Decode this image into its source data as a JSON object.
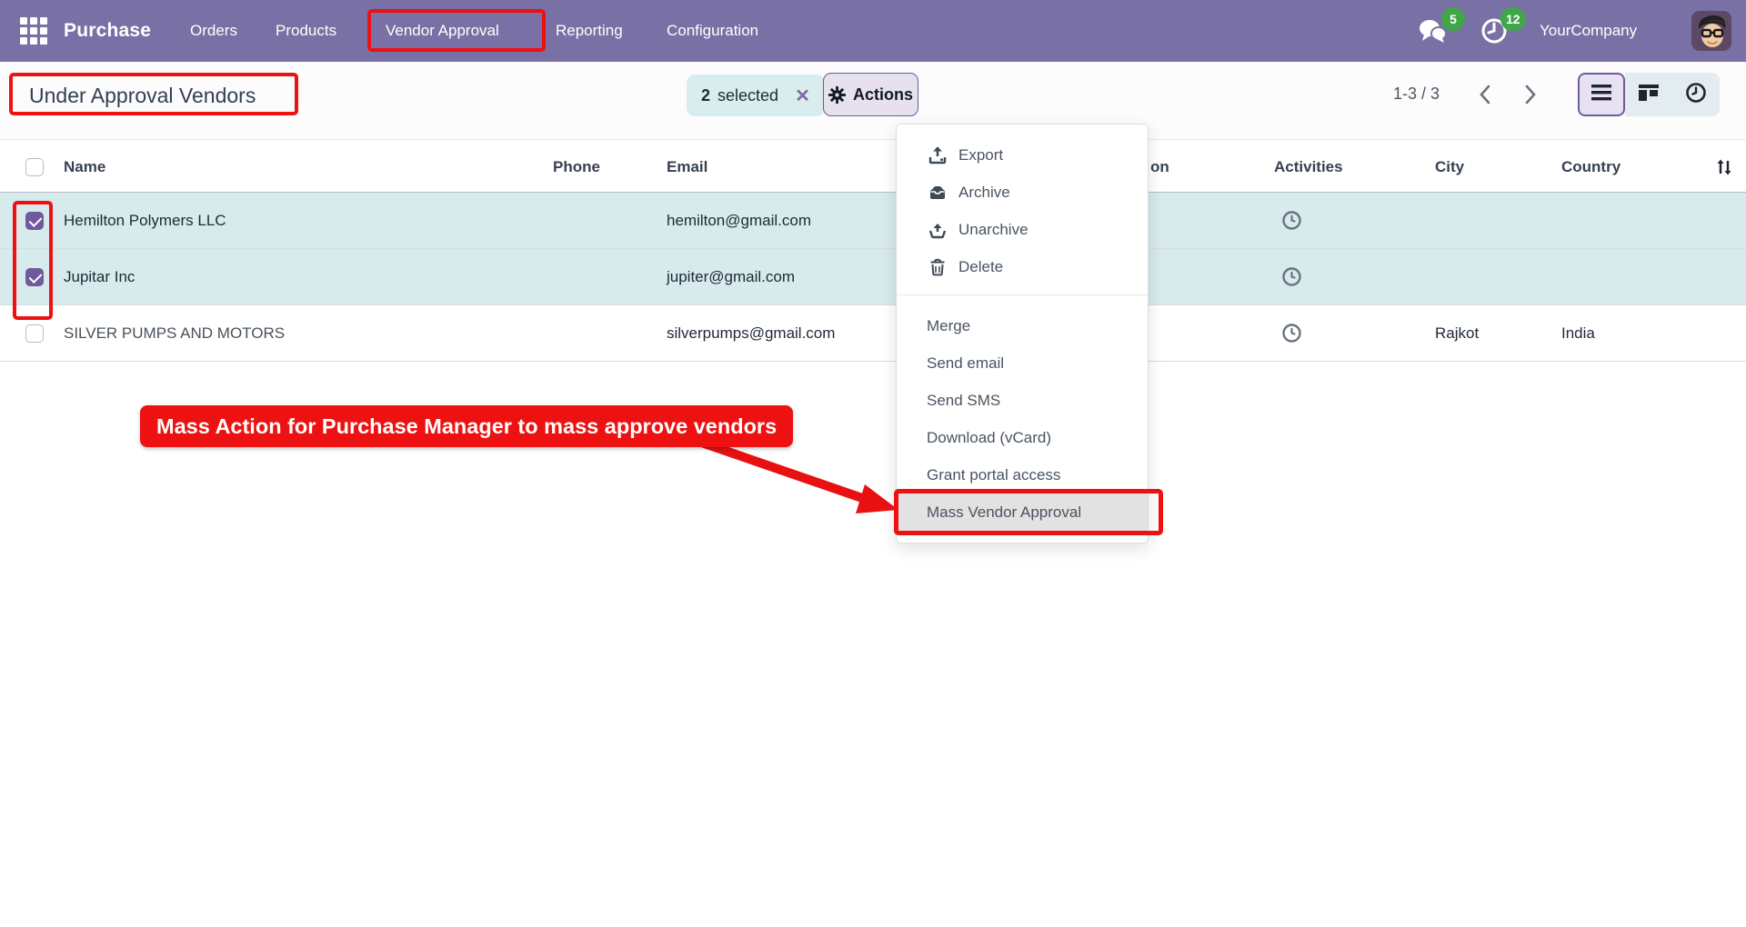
{
  "nav": {
    "app_name": "Purchase",
    "items": [
      {
        "label": "Orders"
      },
      {
        "label": "Products"
      },
      {
        "label": "Vendor Approval"
      },
      {
        "label": "Reporting"
      },
      {
        "label": "Configuration"
      }
    ],
    "badges": {
      "messages": "5",
      "activities": "12"
    },
    "company": "YourCompany"
  },
  "control": {
    "title": "Under Approval Vendors",
    "chip_count": "2",
    "chip_label": "selected",
    "chip_close": "✕",
    "actions_label": "Actions",
    "pager": "1-3 / 3"
  },
  "table": {
    "headers": {
      "name": "Name",
      "phone": "Phone",
      "email": "Email",
      "hidden_fragment": "on",
      "activities": "Activities",
      "city": "City",
      "country": "Country"
    },
    "rows": [
      {
        "name": "Hemilton Polymers LLC",
        "phone": "",
        "email": "hemilton@gmail.com",
        "city": "",
        "country": "",
        "checked": true
      },
      {
        "name": "Jupitar Inc",
        "phone": "",
        "email": "jupiter@gmail.com",
        "city": "",
        "country": "",
        "checked": true
      },
      {
        "name": "SILVER PUMPS AND MOTORS",
        "phone": "",
        "email": "silverpumps@gmail.com",
        "city": "Rajkot",
        "country": "India",
        "checked": false
      }
    ]
  },
  "menu": {
    "groups": [
      {
        "items": [
          {
            "label": "Export",
            "icon": "export-icon"
          },
          {
            "label": "Archive",
            "icon": "archive-icon"
          },
          {
            "label": "Unarchive",
            "icon": "unarchive-icon"
          },
          {
            "label": "Delete",
            "icon": "delete-icon"
          }
        ]
      },
      {
        "items": [
          {
            "label": "Merge"
          },
          {
            "label": "Send email"
          },
          {
            "label": "Send SMS"
          },
          {
            "label": "Download (vCard)"
          },
          {
            "label": "Grant portal access"
          },
          {
            "label": "Mass Vendor Approval",
            "highlighted": true
          }
        ]
      }
    ]
  },
  "annotation": {
    "label": "Mass Action for Purchase Manager to mass approve vendors"
  },
  "icons": [
    "apps-grid-icon",
    "chat-icon",
    "activity-clock-icon",
    "avatar",
    "gear-icon",
    "close-icon",
    "chevron-left-icon",
    "chevron-right-icon",
    "list-view-icon",
    "kanban-view-icon",
    "activity-view-icon",
    "export-icon",
    "archive-icon",
    "unarchive-icon",
    "delete-icon",
    "clock-icon",
    "optional-columns-icon"
  ],
  "colors": {
    "nav-bg": "#7971a5",
    "red": "#ee1111",
    "row-selected": "#d7eaec",
    "chip-bg": "#d9edee",
    "accent-purple": "#6d5b9c",
    "badge-green": "#41a648"
  }
}
